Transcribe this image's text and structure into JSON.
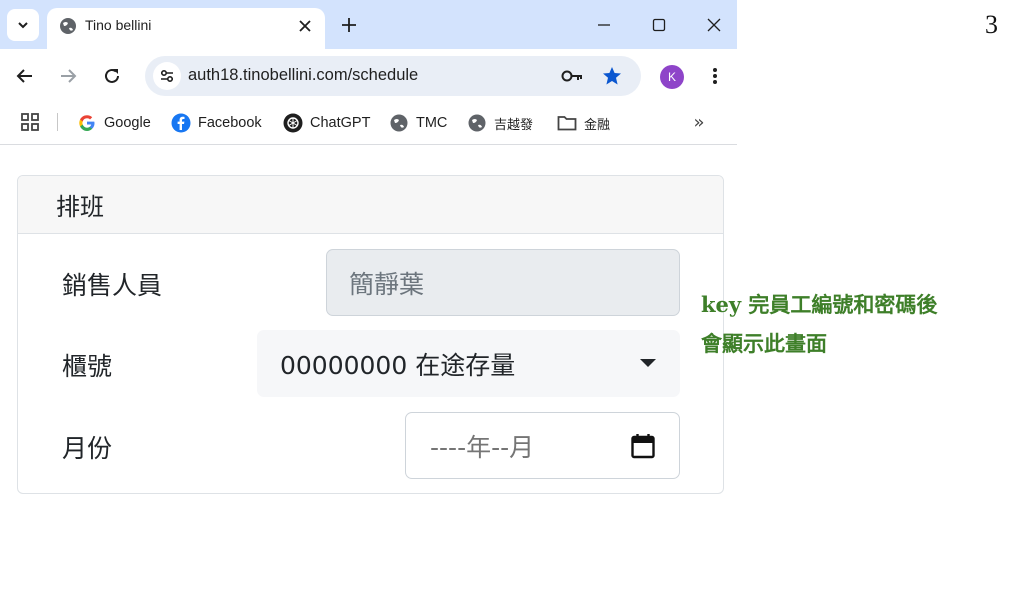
{
  "browser": {
    "tab_title": "Tino bellini",
    "url": "auth18.tinobellini.com/schedule",
    "avatar_initial": "K",
    "bookmarks": [
      {
        "label": "Google",
        "icon": "google-icon"
      },
      {
        "label": "Facebook",
        "icon": "facebook-icon"
      },
      {
        "label": "ChatGPT",
        "icon": "chatgpt-icon"
      },
      {
        "label": "TMC",
        "icon": "globe-icon"
      },
      {
        "label": "吉越發",
        "icon": "globe-icon"
      },
      {
        "label": "金融",
        "icon": "folder-icon"
      }
    ]
  },
  "card": {
    "title": "排班",
    "salesperson_label": "銷售人員",
    "salesperson_value": "簡靜葉",
    "counter_label": "櫃號",
    "counter_value": "00000000 在途存量",
    "month_label": "月份",
    "month_placeholder": "----年--月"
  },
  "annotation": {
    "line1": "key 完員工編號和密碼後",
    "line2": "會顯示此畫面"
  },
  "page_number": "3",
  "colors": {
    "tabstrip": "#d3e3fd",
    "accent_star": "#0b57d0",
    "annotation": "#3e7f29",
    "avatar": "#8e44c9"
  }
}
